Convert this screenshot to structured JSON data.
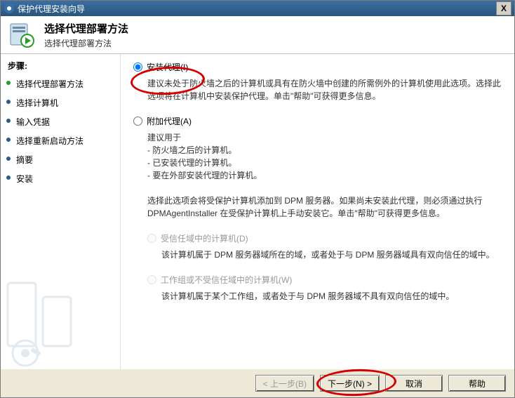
{
  "window": {
    "title": "保护代理安装向导",
    "close_label": "X"
  },
  "header": {
    "title": "选择代理部署方法",
    "subtitle": "选择代理部署方法"
  },
  "sidebar": {
    "heading": "步骤:",
    "items": [
      {
        "label": "选择代理部署方法"
      },
      {
        "label": "选择计算机"
      },
      {
        "label": "输入凭据"
      },
      {
        "label": "选择重新启动方法"
      },
      {
        "label": "摘要"
      },
      {
        "label": "安装"
      }
    ]
  },
  "options": {
    "install": {
      "label": "安装代理(I)",
      "desc": "建议未处于防火墙之后的计算机或具有在防火墙中创建的所需例外的计算机使用此选项。选择此选项将在计算机中安装保护代理。单击\"帮助\"可获得更多信息。"
    },
    "attach": {
      "label": "附加代理(A)",
      "desc_intro": "建议用于",
      "desc_b1": "- 防火墙之后的计算机。",
      "desc_b2": "- 已安装代理的计算机。",
      "desc_b3": "- 要在外部安装代理的计算机。",
      "desc2": "选择此选项会将受保护计算机添加到 DPM 服务器。如果尚未安装此代理，则必须通过执行 DPMAgentInstaller 在受保护计算机上手动安装它。单击\"帮助\"可获得更多信息。"
    },
    "trusted": {
      "label": "受信任域中的计算机(D)",
      "desc": "该计算机属于 DPM 服务器域所在的域，或者处于与 DPM 服务器域具有双向信任的域中。"
    },
    "workgroup": {
      "label": "工作组或不受信任域中的计算机(W)",
      "desc": "该计算机属于某个工作组，或者处于与 DPM 服务器域不具有双向信任的域中。"
    }
  },
  "buttons": {
    "back": "< 上一步(B)",
    "next": "下一步(N) >",
    "cancel": "取消",
    "help": "帮助"
  }
}
